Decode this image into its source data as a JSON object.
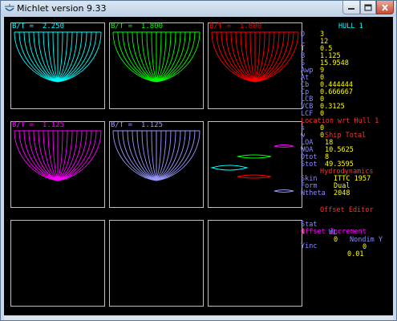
{
  "window": {
    "title": "Michlet version 9.33"
  },
  "panels": [
    {
      "label": "B/T =  2.250",
      "color": "#00ffff"
    },
    {
      "label": "B/T =  1.800",
      "color": "#00ff00"
    },
    {
      "label": "B/T =  1.800",
      "color": "#ff0000"
    },
    {
      "label": "B/T =  1.125",
      "color": "#ff00ff"
    },
    {
      "label": "B/T =  1.125",
      "color": "#9999ff"
    }
  ],
  "hull": {
    "header": "HULL 1",
    "params": [
      {
        "k": "D",
        "v": "3"
      },
      {
        "k": "L",
        "v": "12"
      },
      {
        "k": "T",
        "v": "0.5"
      },
      {
        "k": "B",
        "v": "1.125"
      },
      {
        "k": "S",
        "v": "15.9548"
      },
      {
        "k": "Awp",
        "v": "9"
      },
      {
        "k": "At",
        "v": "0"
      },
      {
        "k": "Cb",
        "v": "0.444444"
      },
      {
        "k": "Cp",
        "v": "0.666667"
      },
      {
        "k": "LCB",
        "v": "0"
      },
      {
        "k": "VCB",
        "v": "0.3125"
      },
      {
        "k": "LCF",
        "v": "0"
      }
    ],
    "location_header": "Location wrt Hull 1",
    "location": [
      {
        "k": "s",
        "v": "0"
      },
      {
        "k": "w",
        "v": "0"
      }
    ]
  },
  "ship_total": {
    "header": "Ship Total",
    "params": [
      {
        "k": "LOA",
        "v": "18"
      },
      {
        "k": "WOA",
        "v": "10.5625"
      },
      {
        "k": "Dtot",
        "v": "8"
      },
      {
        "k": "Stot",
        "v": "49.3595"
      }
    ]
  },
  "hydro": {
    "header": "Hydrodynamics",
    "params": [
      {
        "k": "Skin",
        "v": "ITTC 1957"
      },
      {
        "k": "Form",
        "v": "Dual"
      },
      {
        "k": "Ntheta",
        "v": "2048"
      }
    ]
  },
  "offset_editor": {
    "header": "Offset Editor",
    "cols": {
      "stat": "Stat",
      "wl": "WL",
      "nondim": "Nondim Y"
    },
    "values": {
      "stat": "1",
      "wl": "0",
      "nondim": "0"
    },
    "increment_header": "Offset Increment",
    "yinc_label": "Yinc",
    "yinc_value": "0.01"
  },
  "colors": {
    "white": "#ffffff",
    "header_cyan": "#00ffff",
    "header_red": "#ff3030",
    "header_magenta": "#ff00ff",
    "key_blue": "#8a8aff",
    "value_yellow": "#ffff00"
  }
}
